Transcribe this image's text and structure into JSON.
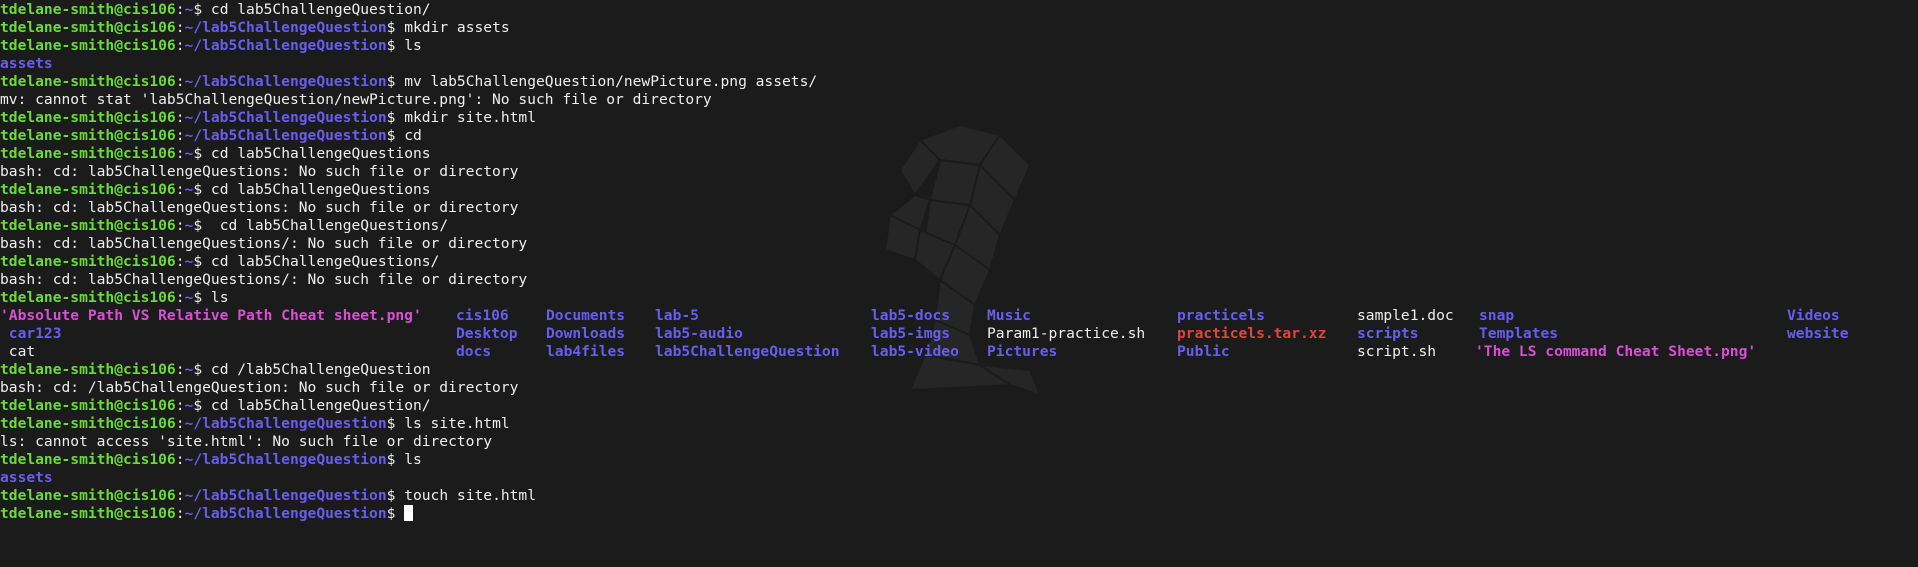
{
  "prompt": {
    "user_host": "tdelane-smith@cis106",
    "sep": ":",
    "home": "~",
    "challenge_path": "~/lab5ChallengeQuestion",
    "dollar": "$ "
  },
  "lines": [
    {
      "path": "~",
      "cmd": "cd lab5ChallengeQuestion/"
    },
    {
      "path": "~/lab5ChallengeQuestion",
      "cmd": "mkdir assets"
    },
    {
      "path": "~/lab5ChallengeQuestion",
      "cmd": "ls"
    },
    {
      "out": "assets",
      "kind": "dir"
    },
    {
      "path": "~/lab5ChallengeQuestion",
      "cmd": "mv lab5ChallengeQuestion/newPicture.png assets/"
    },
    {
      "out": "mv: cannot stat 'lab5ChallengeQuestion/newPicture.png': No such file or directory",
      "kind": "text"
    },
    {
      "path": "~/lab5ChallengeQuestion",
      "cmd": "mkdir site.html"
    },
    {
      "path": "~/lab5ChallengeQuestion",
      "cmd": "cd"
    },
    {
      "path": "~",
      "cmd": "cd lab5ChallengeQuestions"
    },
    {
      "out": "bash: cd: lab5ChallengeQuestions: No such file or directory",
      "kind": "text"
    },
    {
      "path": "~",
      "cmd": "cd lab5ChallengeQuestions"
    },
    {
      "out": "bash: cd: lab5ChallengeQuestions: No such file or directory",
      "kind": "text"
    },
    {
      "path": "~",
      "cmd": " cd lab5ChallengeQuestions/"
    },
    {
      "out": "bash: cd: lab5ChallengeQuestions/: No such file or directory",
      "kind": "text"
    },
    {
      "path": "~",
      "cmd": "cd lab5ChallengeQuestions/"
    },
    {
      "out": "bash: cd: lab5ChallengeQuestions/: No such file or directory",
      "kind": "text"
    },
    {
      "path": "~",
      "cmd": "ls"
    },
    {
      "ls_row": 0
    },
    {
      "ls_row": 1
    },
    {
      "ls_row": 2
    },
    {
      "path": "~",
      "cmd": "cd /lab5ChallengeQuestion"
    },
    {
      "out": "bash: cd: /lab5ChallengeQuestion: No such file or directory",
      "kind": "text"
    },
    {
      "path": "~",
      "cmd": "cd lab5ChallengeQuestion/"
    },
    {
      "path": "~/lab5ChallengeQuestion",
      "cmd": "ls site.html"
    },
    {
      "out": "ls: cannot access 'site.html': No such file or directory",
      "kind": "text"
    },
    {
      "path": "~/lab5ChallengeQuestion",
      "cmd": "ls"
    },
    {
      "out": "assets",
      "kind": "dir"
    },
    {
      "path": "~/lab5ChallengeQuestion",
      "cmd": "touch site.html"
    },
    {
      "path": "~/lab5ChallengeQuestion",
      "cmd": "",
      "cursor": true
    }
  ],
  "ls_listing": [
    [
      {
        "name": "'Absolute Path VS Relative Path Cheat sheet.png'",
        "kind": "img"
      },
      {
        "name": "cis106",
        "kind": "dir"
      },
      {
        "name": "Documents",
        "kind": "dir"
      },
      {
        "name": "lab-5",
        "kind": "dir"
      },
      {
        "name": "lab5-docs",
        "kind": "dir"
      },
      {
        "name": "Music",
        "kind": "dir"
      },
      {
        "name": "practicels",
        "kind": "dir"
      },
      {
        "name": "sample1.doc",
        "kind": "file"
      },
      {
        "name": "snap",
        "kind": "dir"
      },
      {
        "name": "Videos",
        "kind": "dir"
      }
    ],
    [
      {
        "name": " car123",
        "kind": "dir"
      },
      {
        "name": "Desktop",
        "kind": "dir"
      },
      {
        "name": "Downloads",
        "kind": "dir"
      },
      {
        "name": "lab5-audio",
        "kind": "dir"
      },
      {
        "name": "lab5-imgs",
        "kind": "dir"
      },
      {
        "name": "Param1-practice.sh",
        "kind": "file"
      },
      {
        "name": "practicels.tar.xz",
        "kind": "arc"
      },
      {
        "name": "scripts",
        "kind": "dir"
      },
      {
        "name": "Templates",
        "kind": "dir"
      },
      {
        "name": "website",
        "kind": "dir"
      }
    ],
    [
      {
        "name": " cat",
        "kind": "file"
      },
      {
        "name": "docs",
        "kind": "dir"
      },
      {
        "name": "lab4files",
        "kind": "dir"
      },
      {
        "name": "lab5ChallengeQuestion",
        "kind": "dir"
      },
      {
        "name": "lab5-video",
        "kind": "dir"
      },
      {
        "name": "Pictures",
        "kind": "dir"
      },
      {
        "name": "Public",
        "kind": "dir"
      },
      {
        "name": "script.sh",
        "kind": "file"
      },
      {
        "name": "'The LS command Cheat Sheet.png'",
        "kind": "img"
      }
    ]
  ],
  "colors": {
    "background": "#1b1b1b",
    "user": "#6adb3c",
    "path": "#6b5cf0",
    "directory": "#6b5cf0",
    "image": "#d94fd6",
    "archive": "#e0443f",
    "text": "#eeeeee"
  },
  "icons": {
    "watermark": "low-poly-head-icon"
  }
}
